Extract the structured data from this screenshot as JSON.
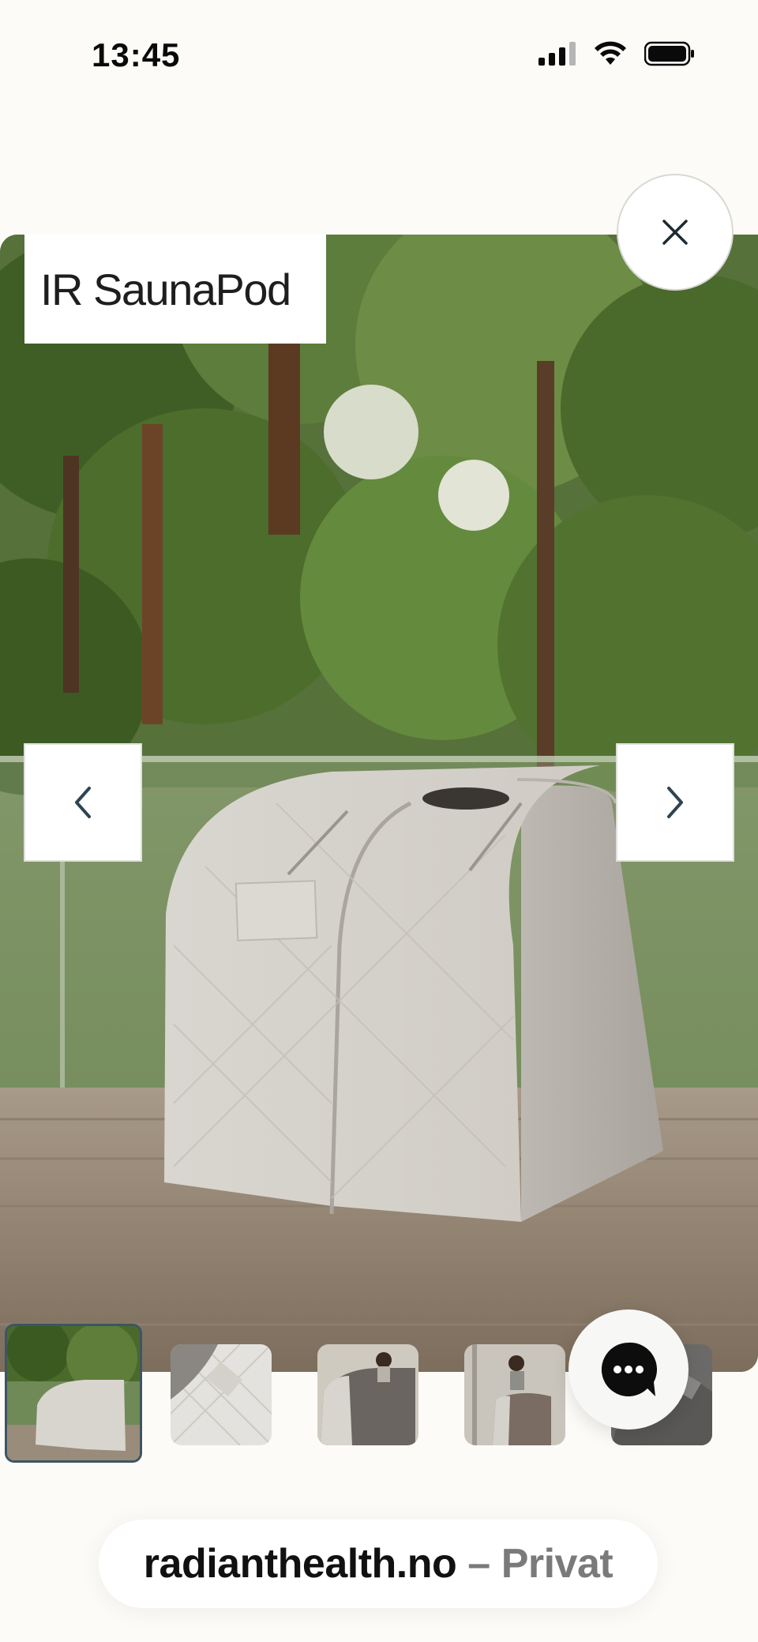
{
  "status_bar": {
    "time": "13:45",
    "icons": [
      "signal-icon",
      "wifi-icon",
      "battery-icon"
    ]
  },
  "product": {
    "title": "IR SaunaPod",
    "image_description_icon": "sauna-photo"
  },
  "controls": {
    "close_icon": "close-icon",
    "prev_icon": "chevron-left-icon",
    "next_icon": "chevron-right-icon",
    "chat_icon": "chat-bubble-icon"
  },
  "thumbnails": {
    "count": 5,
    "selected_index": 0
  },
  "url_bar": {
    "domain": "radianthealth.no",
    "separator": "–",
    "suffix": "Privat"
  },
  "colors": {
    "background": "#fcfbf8",
    "active_thumb_border": "#3e5561",
    "icon_dark": "#2e4452"
  }
}
